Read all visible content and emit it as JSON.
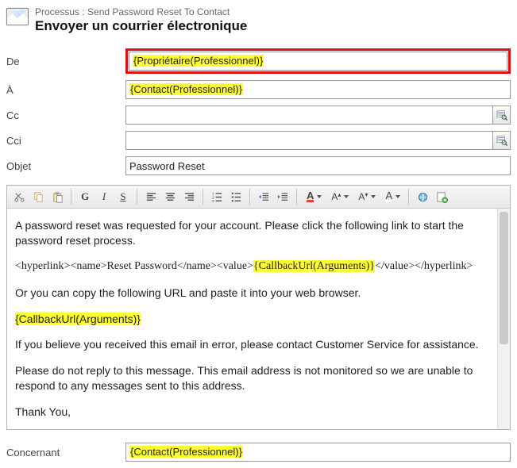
{
  "header": {
    "process_line": "Processus : Send Password Reset To Contact",
    "title": "Envoyer un courrier électronique"
  },
  "fields": {
    "from_label": "De",
    "from_value": "{Propriétaire(Professionnel)}",
    "to_label": "À",
    "to_value": "{Contact(Professionnel)}",
    "cc_label": "Cc",
    "cc_value": "",
    "bcc_label": "Cci",
    "bcc_value": "",
    "subject_label": "Objet",
    "subject_value": "Password Reset",
    "regarding_label": "Concernant",
    "regarding_value": "{Contact(Professionnel)}"
  },
  "toolbar": {
    "cut": "Cut",
    "copy": "Copy",
    "paste": "Paste",
    "bold": "G",
    "italic": "I",
    "underline": "S",
    "font_color": "A",
    "font_grow": "A",
    "font_shrink": "A",
    "highlight": "A"
  },
  "body": {
    "p1": "A password reset was requested for your account. Please click the following link to start the password reset process.",
    "hyper_open": "<hyperlink><name>Reset Password</name><value>",
    "callback1": "{CallbackUrl(Arguments)}",
    "hyper_close": "</value></hyperlink>",
    "p3": "Or you can copy the following URL and paste it into your web browser.",
    "callback2": "{CallbackUrl(Arguments)}",
    "p5": "If you believe you received this email in error, please contact Customer Service for assistance.",
    "p6": "Please do not reply to this message. This email address is not monitored so we are unable to respond to any messages sent to this address.",
    "p7": "Thank You,"
  }
}
